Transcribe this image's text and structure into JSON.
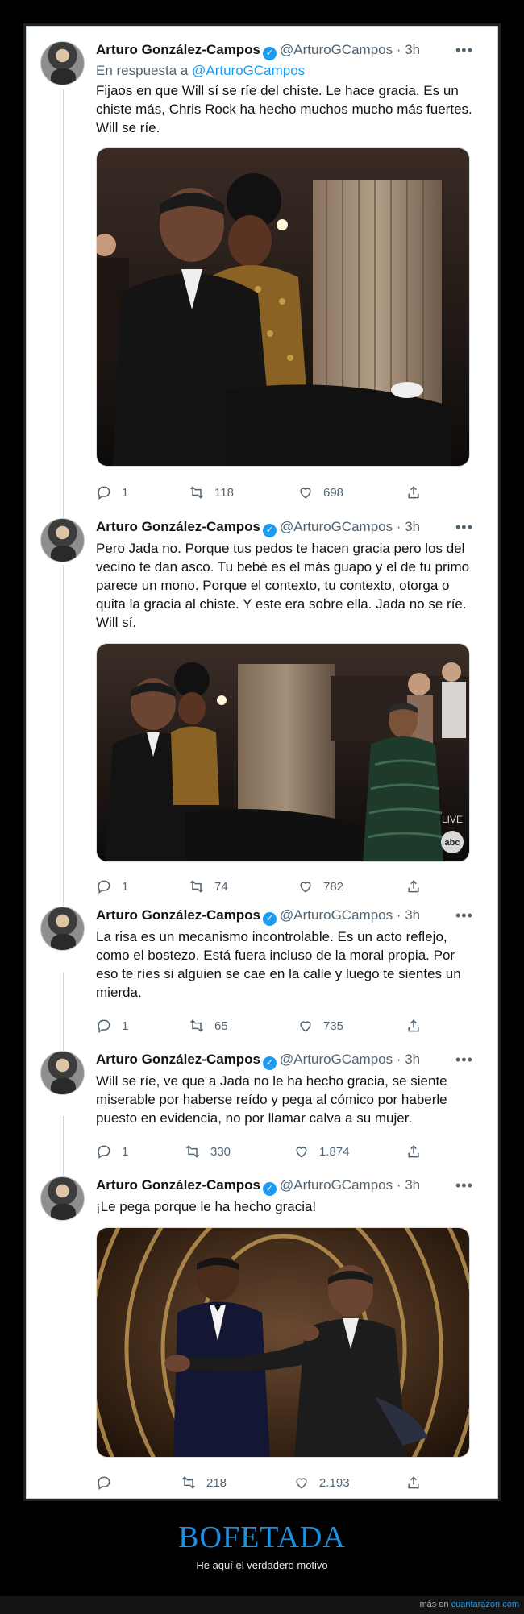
{
  "author": {
    "name": "Arturo González-Campos",
    "handle": "@ArturoGCampos",
    "time": "· 3h"
  },
  "tweets": [
    {
      "reply_prefix": "En respuesta a",
      "reply_handle": "@ArturoGCampos",
      "text": "Fijaos en que Will sí se ríe del chiste. Le hace gracia. Es un chiste más, Chris Rock ha hecho muchos mucho más fuertes. Will se ríe.",
      "replies": "1",
      "retweets": "118",
      "likes": "698"
    },
    {
      "text": "Pero Jada no. Porque tus pedos te hacen gracia pero los del vecino te dan asco. Tu bebé es el más guapo y el de tu primo parece un mono. Porque el contexto, tu contexto, otorga o quita la gracia al chiste. Y este era sobre ella. Jada no se ríe. Will sí.",
      "replies": "1",
      "retweets": "74",
      "likes": "782",
      "photo_badge_live": "LIVE",
      "photo_badge_logo": "abc"
    },
    {
      "text": "La risa es un mecanismo incontrolable. Es un acto reflejo, como el bostezo. Está fuera incluso de la moral propia. Por eso te ríes si alguien se cae en la calle y luego te sientes un mierda.",
      "replies": "1",
      "retweets": "65",
      "likes": "735"
    },
    {
      "text": "Will se ríe, ve que a Jada no le ha hecho gracia, se siente miserable por haberse reído y pega al cómico por haberle puesto en evidencia, no por llamar calva a su mujer.",
      "replies": "1",
      "retweets": "330",
      "likes": "1.874"
    },
    {
      "text": "¡Le pega porque le ha hecho gracia!",
      "replies": "",
      "retweets": "218",
      "likes": "2.193"
    }
  ],
  "footer": {
    "title": "BOFETADA",
    "subtitle": "He aquí el verdadero motivo",
    "credit_prefix": "más en",
    "credit_site": "cuantarazon.com"
  },
  "icons": {
    "more": "more-horizontal-icon",
    "verified": "verified-badge-icon",
    "reply": "reply-icon",
    "retweet": "retweet-icon",
    "like": "heart-icon",
    "share": "share-icon"
  },
  "colors": {
    "accent": "#1d9bf0",
    "footer_title": "#1d8fe0",
    "text": "#0f1419",
    "muted": "#536471",
    "background": "#000000"
  }
}
